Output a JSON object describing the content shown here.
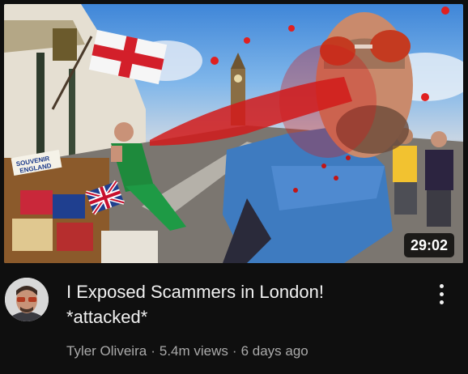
{
  "video": {
    "duration": "29:02",
    "title_line1": "I Exposed Scammers in London!",
    "title_line2": "*attacked*",
    "channel": "Tyler Oliveira",
    "views": "5.4m views",
    "age": "6 days ago",
    "separator": "·"
  },
  "thumbnail": {
    "sign_text_line1": "SOUVENIR",
    "sign_text_line2": "ENGLAND"
  },
  "colors": {
    "background": "#0f0f0f",
    "title": "#f1f1f1",
    "meta_text": "#aaaaaa",
    "badge_bg": "#000000"
  },
  "icons": {
    "more": "vertical-ellipsis-icon"
  }
}
